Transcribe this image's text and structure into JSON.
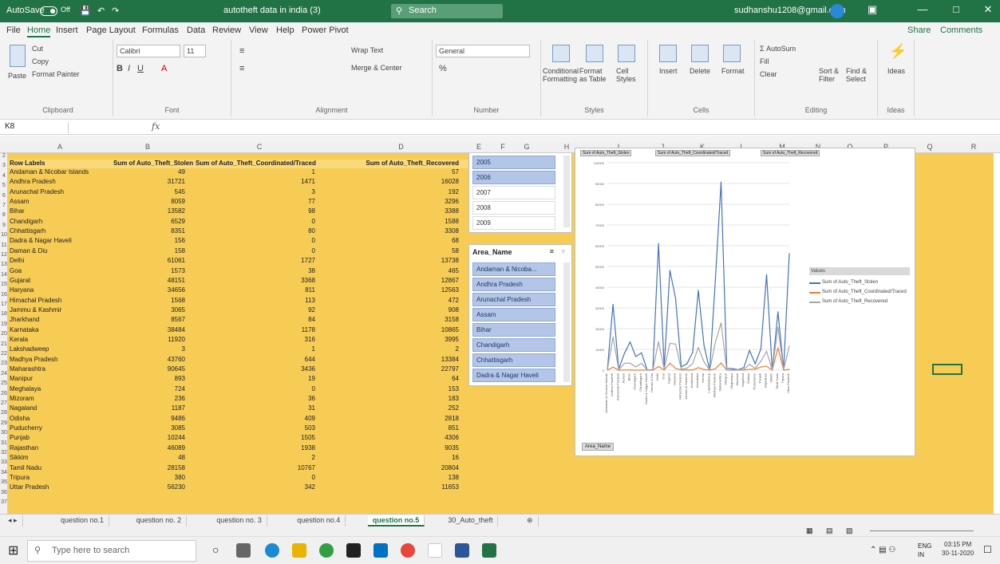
{
  "titlebar": {
    "autosave_label": "AutoSave",
    "autosave_state": "Off",
    "doc_title": "autotheft data in india (3)",
    "search_placeholder": "Search",
    "user_email": "sudhanshu1208@gmail.com"
  },
  "menu": {
    "tabs": [
      "File",
      "Home",
      "Insert",
      "Page Layout",
      "Formulas",
      "Data",
      "Review",
      "View",
      "Help",
      "Power Pivot"
    ],
    "share": "Share",
    "comments": "Comments"
  },
  "ribbon": {
    "clipboard": {
      "paste": "Paste",
      "cut": "Cut",
      "copy": "Copy",
      "format_painter": "Format Painter",
      "name": "Clipboard"
    },
    "font": {
      "family": "Calibri",
      "size": "11",
      "name": "Font"
    },
    "alignment": {
      "wrap": "Wrap Text",
      "merge": "Merge & Center",
      "name": "Alignment"
    },
    "number": {
      "format": "General",
      "name": "Number"
    },
    "styles": {
      "conditional": "Conditional Formatting",
      "table": "Format as Table",
      "cell": "Cell Styles",
      "name": "Styles"
    },
    "cells": {
      "insert": "Insert",
      "delete": "Delete",
      "format": "Format",
      "name": "Cells"
    },
    "editing": {
      "autosum": "AutoSum",
      "fill": "Fill",
      "clear": "Clear",
      "sort": "Sort & Filter",
      "find": "Find & Select",
      "name": "Editing"
    },
    "ideas": {
      "label": "Ideas",
      "name": "Ideas"
    }
  },
  "formula_bar": {
    "cell_ref": "K8",
    "fx": "fx"
  },
  "columns": [
    "A",
    "B",
    "C",
    "D",
    "E",
    "F",
    "G",
    "H",
    "I",
    "J",
    "K",
    "L",
    "M",
    "N",
    "O",
    "P",
    "Q",
    "R"
  ],
  "pivot": {
    "headers": [
      "Row Labels",
      "Sum of Auto_Theft_Stolen",
      "Sum of Auto_Theft_Coordinated/Traced",
      "Sum of Auto_Theft_Recovered"
    ],
    "rows": [
      [
        "Andaman & Nicobar Islands",
        "49",
        "1",
        "57"
      ],
      [
        "Andhra Pradesh",
        "31721",
        "1471",
        "16028"
      ],
      [
        "Arunachal Pradesh",
        "545",
        "3",
        "192"
      ],
      [
        "Assam",
        "8059",
        "77",
        "3296"
      ],
      [
        "Bihar",
        "13582",
        "98",
        "3388"
      ],
      [
        "Chandigarh",
        "6529",
        "0",
        "1588"
      ],
      [
        "Chhattisgarh",
        "8351",
        "80",
        "3308"
      ],
      [
        "Dadra & Nagar Haveli",
        "156",
        "0",
        "68"
      ],
      [
        "Daman & Diu",
        "158",
        "0",
        "58"
      ],
      [
        "Delhi",
        "61061",
        "1727",
        "13738"
      ],
      [
        "Goa",
        "1573",
        "38",
        "465"
      ],
      [
        "Gujarat",
        "48151",
        "3368",
        "12867"
      ],
      [
        "Haryana",
        "34656",
        "811",
        "12563"
      ],
      [
        "Himachal Pradesh",
        "1568",
        "113",
        "472"
      ],
      [
        "Jammu & Kashmir",
        "3065",
        "92",
        "908"
      ],
      [
        "Jharkhand",
        "8567",
        "84",
        "3158"
      ],
      [
        "Karnataka",
        "38484",
        "1178",
        "10865"
      ],
      [
        "Kerala",
        "11920",
        "316",
        "3995"
      ],
      [
        "Lakshadweep",
        "3",
        "1",
        "2"
      ],
      [
        "Madhya Pradesh",
        "43760",
        "644",
        "13384"
      ],
      [
        "Maharashtra",
        "90645",
        "3436",
        "22797"
      ],
      [
        "Manipur",
        "893",
        "19",
        "64"
      ],
      [
        "Meghalaya",
        "724",
        "0",
        "153"
      ],
      [
        "Mizoram",
        "236",
        "36",
        "183"
      ],
      [
        "Nagaland",
        "1187",
        "31",
        "252"
      ],
      [
        "Odisha",
        "9486",
        "409",
        "2818"
      ],
      [
        "Puducherry",
        "3085",
        "503",
        "851"
      ],
      [
        "Punjab",
        "10244",
        "1505",
        "4306"
      ],
      [
        "Rajasthan",
        "46089",
        "1938",
        "9035"
      ],
      [
        "Sikkim",
        "48",
        "2",
        "16"
      ],
      [
        "Tamil Nadu",
        "28158",
        "10767",
        "20804"
      ],
      [
        "Tripura",
        "380",
        "0",
        "138"
      ],
      [
        "Uttar Pradesh",
        "56230",
        "342",
        "11653"
      ]
    ]
  },
  "year_slicer": {
    "items": [
      "2005",
      "2006",
      "2007",
      "2008",
      "2009"
    ]
  },
  "area_slicer": {
    "title": "Area_Name",
    "items": [
      "Andaman & Nicoba...",
      "Andhra Pradesh",
      "Arunachal Pradesh",
      "Assam",
      "Bihar",
      "Chandigarh",
      "Chhattisgarh",
      "Dadra & Nagar Haveli"
    ]
  },
  "chart": {
    "field_buttons": [
      "Sum of Auto_Theft_Stolen",
      "Sum of Auto_Theft_Coordinated/Traced",
      "Sum of Auto_Theft_Recovered"
    ],
    "legend_title": "Values",
    "axis_button": "Area_Name",
    "colors": {
      "stolen": "#4472c4",
      "coordinated": "#ed7d31",
      "recovered": "#a5a5a5"
    }
  },
  "chart_data": {
    "type": "line",
    "categories": [
      "Andaman & Nicobar Islands",
      "Andhra Pradesh",
      "Arunachal Pradesh",
      "Assam",
      "Bihar",
      "Chandigarh",
      "Chhattisgarh",
      "Dadra & Nagar Haveli",
      "Daman & Diu",
      "Delhi",
      "Goa",
      "Gujarat",
      "Haryana",
      "Himachal Pradesh",
      "Jammu & Kashmir",
      "Jharkhand",
      "Karnataka",
      "Kerala",
      "Lakshadweep",
      "Madhya Pradesh",
      "Maharashtra",
      "Manipur",
      "Meghalaya",
      "Mizoram",
      "Nagaland",
      "Odisha",
      "Puducherry",
      "Punjab",
      "Rajasthan",
      "Sikkim",
      "Tamil Nadu",
      "Tripura",
      "Uttar Pradesh"
    ],
    "series": [
      {
        "name": "Sum of Auto_Theft_Stolen",
        "values": [
          49,
          31721,
          545,
          8059,
          13582,
          6529,
          8351,
          156,
          158,
          61061,
          1573,
          48151,
          34656,
          1568,
          3065,
          8567,
          38484,
          11920,
          3,
          43760,
          90645,
          893,
          724,
          236,
          1187,
          9486,
          3085,
          10244,
          46089,
          48,
          28158,
          380,
          56230
        ]
      },
      {
        "name": "Sum of Auto_Theft_Coordinated/Traced",
        "values": [
          1,
          1471,
          3,
          77,
          98,
          0,
          80,
          0,
          0,
          1727,
          38,
          3368,
          811,
          113,
          92,
          84,
          1178,
          316,
          1,
          644,
          3436,
          19,
          0,
          36,
          31,
          409,
          503,
          1505,
          1938,
          2,
          10767,
          0,
          342
        ]
      },
      {
        "name": "Sum of Auto_Theft_Recovered",
        "values": [
          57,
          16028,
          192,
          3296,
          3388,
          1588,
          3308,
          68,
          58,
          13738,
          465,
          12867,
          12563,
          472,
          908,
          3158,
          10865,
          3995,
          2,
          13384,
          22797,
          64,
          153,
          183,
          252,
          2818,
          851,
          4306,
          9035,
          16,
          20804,
          138,
          11653
        ]
      }
    ],
    "ylim": [
      0,
      100000
    ],
    "legend": "right"
  },
  "sheets": {
    "tabs": [
      "question no.1",
      "question no. 2",
      "question no. 3",
      "question no.4",
      "question no.5",
      "30_Auto_theft"
    ],
    "active_index": 4
  },
  "taskbar": {
    "search_placeholder": "Type here to search",
    "lang": "ENG",
    "region": "IN",
    "time": "03:15 PM",
    "date": "30-11-2020"
  }
}
